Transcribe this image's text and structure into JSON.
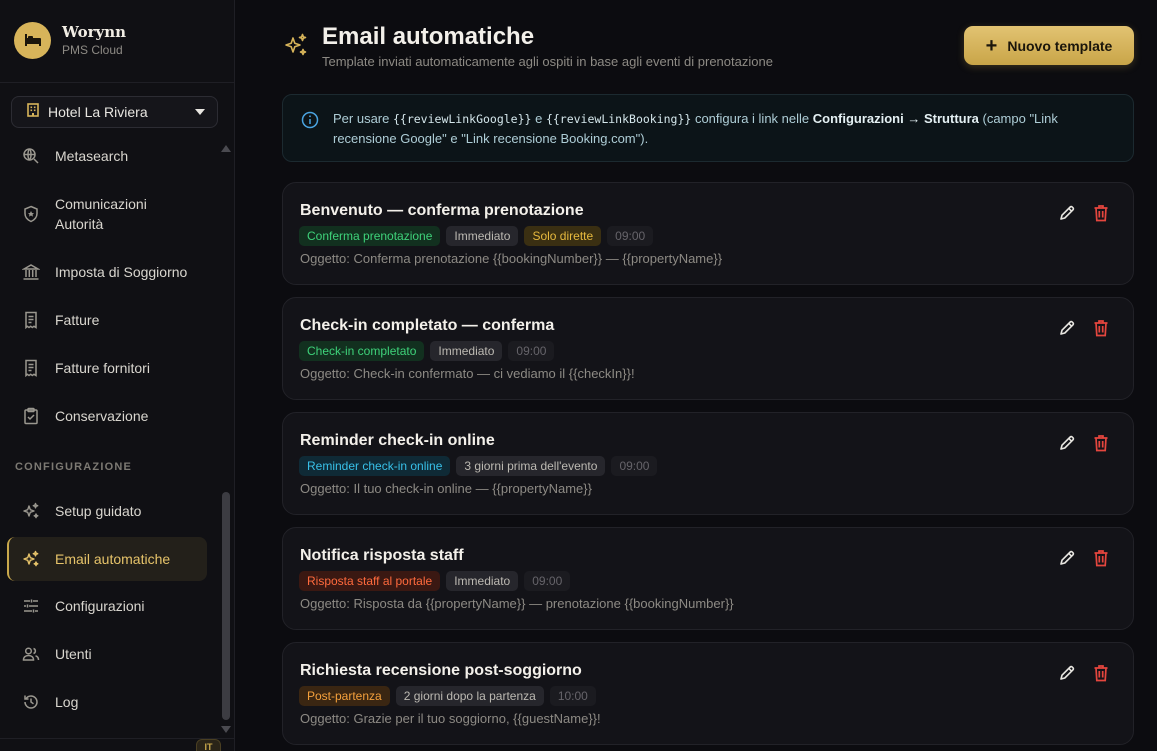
{
  "brand": {
    "name": "Worynn",
    "subtitle": "PMS Cloud"
  },
  "hotel_select": {
    "value": "Hotel La Riviera"
  },
  "sidebar": {
    "items_top": [
      {
        "label": "Metasearch",
        "icon": "search-globe-icon"
      },
      {
        "label": "Comunicazioni Autorità",
        "icon": "shield-star-icon"
      },
      {
        "label": "Imposta di Soggiorno",
        "icon": "bank-icon"
      },
      {
        "label": "Fatture",
        "icon": "receipt-icon"
      },
      {
        "label": "Fatture fornitori",
        "icon": "receipt-icon"
      },
      {
        "label": "Conservazione",
        "icon": "clipboard-check-icon"
      }
    ],
    "section_title": "CONFIGURAZIONE",
    "items_config": [
      {
        "label": "Setup guidato",
        "icon": "sparkles-icon"
      },
      {
        "label": "Email automatiche",
        "icon": "sparkles-icon",
        "active": true
      },
      {
        "label": "Configurazioni",
        "icon": "sliders-icon"
      },
      {
        "label": "Utenti",
        "icon": "users-icon"
      },
      {
        "label": "Log",
        "icon": "history-icon"
      }
    ],
    "lang_button": "IT"
  },
  "header": {
    "title": "Email automatiche",
    "subtitle": "Template inviati automaticamente agli ospiti in base agli eventi di prenotazione",
    "new_button": "Nuovo template"
  },
  "info": {
    "p1": "Per usare ",
    "code1": "{{reviewLinkGoogle}}",
    "p2": " e ",
    "code2": "{{reviewLinkBooking}}",
    "p3": " configura i link nelle ",
    "b1": "Configurazioni",
    "arrow": " → ",
    "b2": "Struttura",
    "p4": " (campo \"Link recensione Google\" e \"Link recensione Booking.com\")."
  },
  "templates": [
    {
      "title": "Benvenuto — conferma prenotazione",
      "tags": [
        {
          "label": "Conferma prenotazione",
          "kind": "green"
        },
        {
          "label": "Immediato",
          "kind": "neutral"
        },
        {
          "label": "Solo dirette",
          "kind": "gold"
        },
        {
          "label": "09:00",
          "kind": "time"
        }
      ],
      "subject": "Oggetto: Conferma prenotazione {{bookingNumber}} — {{propertyName}}"
    },
    {
      "title": "Check-in completato — conferma",
      "tags": [
        {
          "label": "Check-in completato",
          "kind": "green"
        },
        {
          "label": "Immediato",
          "kind": "neutral"
        },
        {
          "label": "09:00",
          "kind": "time"
        }
      ],
      "subject": "Oggetto: Check-in confermato — ci vediamo il {{checkIn}}!"
    },
    {
      "title": "Reminder check-in online",
      "tags": [
        {
          "label": "Reminder check-in online",
          "kind": "blue"
        },
        {
          "label": "3 giorni prima dell'evento",
          "kind": "neutral"
        },
        {
          "label": "09:00",
          "kind": "time"
        }
      ],
      "subject": "Oggetto: Il tuo check-in online — {{propertyName}}"
    },
    {
      "title": "Notifica risposta staff",
      "tags": [
        {
          "label": "Risposta staff al portale",
          "kind": "red"
        },
        {
          "label": "Immediato",
          "kind": "neutral"
        },
        {
          "label": "09:00",
          "kind": "time"
        }
      ],
      "subject": "Oggetto: Risposta da {{propertyName}} — prenotazione {{bookingNumber}}"
    },
    {
      "title": "Richiesta recensione post-soggiorno",
      "tags": [
        {
          "label": "Post-partenza",
          "kind": "orange"
        },
        {
          "label": "2 giorni dopo la partenza",
          "kind": "neutral"
        },
        {
          "label": "10:00",
          "kind": "time"
        }
      ],
      "subject": "Oggetto: Grazie per il tuo soggiorno, {{guestName}}!"
    }
  ],
  "tag_colors": {
    "green": {
      "bg": "#12301f",
      "fg": "#3ed27a"
    },
    "gold": {
      "bg": "#3a2f12",
      "fg": "#e6b93e"
    },
    "blue": {
      "bg": "#0f2a36",
      "fg": "#38c0e8"
    },
    "red": {
      "bg": "#3a1812",
      "fg": "#ff6a3d"
    },
    "orange": {
      "bg": "#3a2612",
      "fg": "#f5a13c"
    }
  }
}
